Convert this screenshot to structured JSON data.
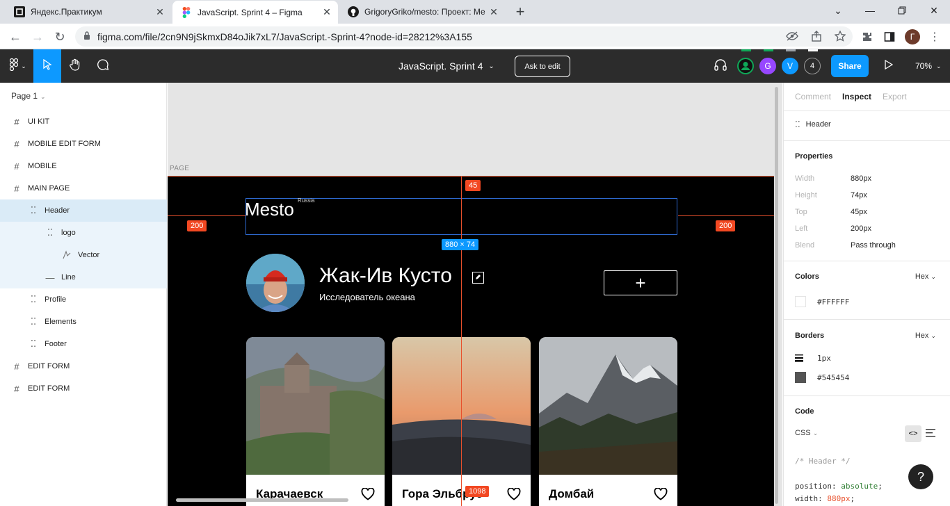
{
  "browser": {
    "tabs": [
      {
        "title": "Яндекс.Практикум",
        "icon": "practicum-icon",
        "active": false
      },
      {
        "title": "JavaScript. Sprint 4 – Figma",
        "icon": "figma-icon",
        "active": true
      },
      {
        "title": "GrigoryGriko/mesto: Проект: Ме",
        "icon": "github-icon",
        "active": false
      }
    ],
    "url": "figma.com/file/2cn9N9jSkmxD84oJik7xL7/JavaScript.-Sprint-4?node-id=28212%3A155",
    "profile_initial": "Г"
  },
  "toolbar": {
    "doc_title": "JavaScript. Sprint 4",
    "ask_to_edit": "Ask to edit",
    "avatars": [
      {
        "label": "",
        "color": "#0fa958"
      },
      {
        "label": "G",
        "color": "#9747ff"
      },
      {
        "label": "V",
        "color": "#0d99ff"
      },
      {
        "label": "4",
        "color": "#2c2c2c"
      }
    ],
    "share": "Share",
    "zoom": "70%"
  },
  "layers": {
    "page": "Page 1",
    "items": [
      {
        "name": "UI KIT",
        "type": "frame"
      },
      {
        "name": "MOBILE EDIT FORM",
        "type": "frame"
      },
      {
        "name": "MOBILE",
        "type": "frame"
      },
      {
        "name": "MAIN PAGE",
        "type": "frame"
      },
      {
        "name": "Header",
        "type": "group"
      },
      {
        "name": "logo",
        "type": "group"
      },
      {
        "name": "Vector",
        "type": "vector"
      },
      {
        "name": "Line",
        "type": "line"
      },
      {
        "name": "Profile",
        "type": "group"
      },
      {
        "name": "Elements",
        "type": "group"
      },
      {
        "name": "Footer",
        "type": "group"
      },
      {
        "name": "EDIT FORM",
        "type": "frame"
      },
      {
        "name": "EDIT FORM",
        "type": "frame"
      }
    ]
  },
  "canvas": {
    "page_label": "PAGE",
    "measure_top": "45",
    "measure_left": "200",
    "measure_right": "200",
    "size_badge": "880 × 74",
    "measure_bottom": "1098",
    "logo_text": "Mesto",
    "logo_sub": "Russia",
    "profile_name": "Жак-Ив Кусто",
    "profile_job": "Исследователь океана",
    "add_label": "+",
    "cards": [
      {
        "title": "Карачаевск"
      },
      {
        "title": "Гора Эльбрус"
      },
      {
        "title": "Домбай"
      }
    ]
  },
  "inspect": {
    "tabs": [
      "Comment",
      "Inspect",
      "Export"
    ],
    "active_tab": "Inspect",
    "layer_name": "Header",
    "properties_title": "Properties",
    "properties": [
      {
        "k": "Width",
        "v": "880px"
      },
      {
        "k": "Height",
        "v": "74px"
      },
      {
        "k": "Top",
        "v": "45px"
      },
      {
        "k": "Left",
        "v": "200px"
      },
      {
        "k": "Blend",
        "v": "Pass through"
      }
    ],
    "colors_title": "Colors",
    "colors_format": "Hex",
    "color_value": "#FFFFFF",
    "borders_title": "Borders",
    "borders_format": "Hex",
    "border_width": "1px",
    "border_color": "#545454",
    "code_title": "Code",
    "code_lang": "CSS",
    "code_comment": "/* Header */",
    "code_line1_prop": "position:",
    "code_line1_val": "absolute",
    "code_line2_prop": "width:",
    "code_line2_val": "880px",
    "help": "?"
  }
}
